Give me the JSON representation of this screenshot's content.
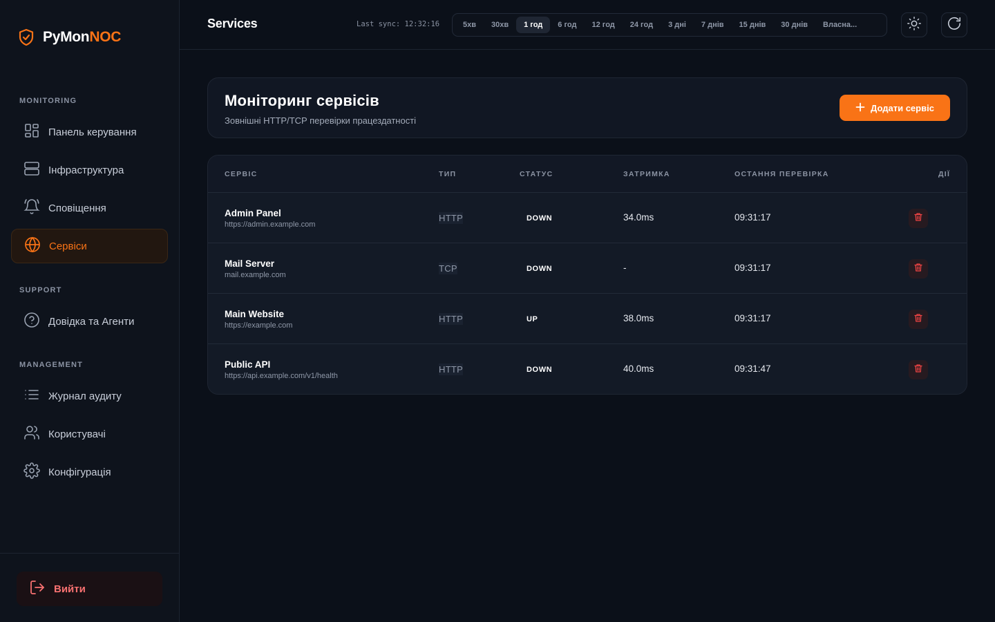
{
  "brand": {
    "name_part1": "PyMon",
    "name_part2": "NOC"
  },
  "sidebar": {
    "sections": [
      {
        "label": "MONITORING"
      },
      {
        "label": "SUPPORT"
      },
      {
        "label": "MANAGEMENT"
      }
    ],
    "items": [
      {
        "label": "Панель керування",
        "icon": "dashboard-icon"
      },
      {
        "label": "Інфраструктура",
        "icon": "server-icon"
      },
      {
        "label": "Сповіщення",
        "icon": "bell-icon"
      },
      {
        "label": "Сервіси",
        "icon": "globe-icon",
        "active": true
      },
      {
        "label": "Довідка та Агенти",
        "icon": "help-icon"
      },
      {
        "label": "Журнал аудиту",
        "icon": "list-icon"
      },
      {
        "label": "Користувачі",
        "icon": "users-icon"
      },
      {
        "label": "Конфігурація",
        "icon": "gear-icon"
      }
    ],
    "logout_label": "Вийти"
  },
  "header": {
    "title": "Services",
    "last_sync": "Last sync: 12:32:16",
    "ranges": [
      "5хв",
      "30хв",
      "1 год",
      "6 год",
      "12 год",
      "24 год",
      "3 дні",
      "7 днів",
      "15 днів",
      "30 днів",
      "Власна..."
    ],
    "active_range": "1 год"
  },
  "main": {
    "title": "Моніторинг сервісів",
    "subtitle": "Зовнішні HTTP/TCP перевірки працездатності",
    "add_label": "Додати сервіс"
  },
  "table": {
    "columns": [
      "СЕРВІС",
      "ТИП",
      "СТАТУС",
      "ЗАТРИМКА",
      "ОСТАННЯ ПЕРЕВІРКА",
      "ДІЇ"
    ],
    "rows": [
      {
        "name": "Admin Panel",
        "url": "https://admin.example.com",
        "type": "HTTP",
        "status": "DOWN",
        "latency": "34.0ms",
        "last_check": "09:31:17"
      },
      {
        "name": "Mail Server",
        "url": "mail.example.com",
        "type": "TCP",
        "status": "DOWN",
        "latency": "-",
        "last_check": "09:31:17"
      },
      {
        "name": "Main Website",
        "url": "https://example.com",
        "type": "HTTP",
        "status": "UP",
        "latency": "38.0ms",
        "last_check": "09:31:17"
      },
      {
        "name": "Public API",
        "url": "https://api.example.com/v1/health",
        "type": "HTTP",
        "status": "DOWN",
        "latency": "40.0ms",
        "last_check": "09:31:47"
      }
    ]
  },
  "colors": {
    "accent": "#f97316",
    "background": "#0b1019",
    "danger": "#ef4444"
  }
}
